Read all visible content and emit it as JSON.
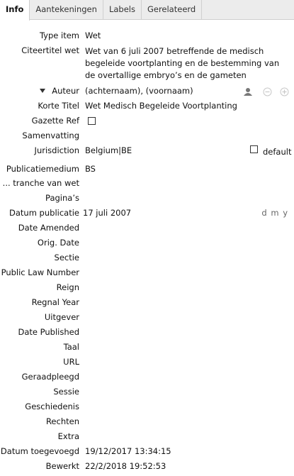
{
  "tabs": [
    "Info",
    "Aantekeningen",
    "Labels",
    "Gerelateerd"
  ],
  "fields": {
    "type_item": {
      "label": "Type item",
      "value": "Wet"
    },
    "citeertitel": {
      "label": "Citeertitel wet",
      "value": "Wet van 6 juli 2007 betreffende de medisch begeleide voortplanting en de bestemming van de overtallige embryo’s en de gameten"
    },
    "auteur": {
      "label": "Auteur",
      "value": "(achternaam), (voornaam)"
    },
    "korte_titel": {
      "label": "Korte Titel",
      "value": "Wet Medisch Begeleide Voortplanting"
    },
    "gazette_ref": {
      "label": "Gazette Ref"
    },
    "samenvatting": {
      "label": "Samenvatting"
    },
    "jurisdiction": {
      "label": "Jurisdiction",
      "value": "Belgium|BE",
      "default_label": "default"
    },
    "publicatiemedium": {
      "label": "Publicatiemedium",
      "value": "BS"
    },
    "tranche": {
      "label": "... tranche van wet"
    },
    "paginas": {
      "label": "Pagina’s"
    },
    "datum_publicatie": {
      "label": "Datum publicatie",
      "value": "17 juli 2007",
      "format": "d m y"
    },
    "date_amended": {
      "label": "Date Amended"
    },
    "orig_date": {
      "label": "Orig. Date"
    },
    "sectie": {
      "label": "Sectie"
    },
    "public_law_number": {
      "label": "Public Law Number"
    },
    "reign": {
      "label": "Reign"
    },
    "regnal_year": {
      "label": "Regnal Year"
    },
    "uitgever": {
      "label": "Uitgever"
    },
    "date_published": {
      "label": "Date Published"
    },
    "taal": {
      "label": "Taal"
    },
    "url": {
      "label": "URL"
    },
    "geraadpleegd": {
      "label": "Geraadpleegd"
    },
    "sessie": {
      "label": "Sessie"
    },
    "geschiedenis": {
      "label": "Geschiedenis"
    },
    "rechten": {
      "label": "Rechten"
    },
    "extra": {
      "label": "Extra"
    },
    "datum_toegevoegd": {
      "label": "Datum toegevoegd",
      "value": "19/12/2017 13:34:15"
    },
    "bewerkt": {
      "label": "Bewerkt",
      "value": "22/2/2018 19:52:53"
    }
  },
  "icons": {
    "author_type": "person-icon",
    "remove": "minus-circle-icon",
    "add": "plus-circle-icon"
  }
}
